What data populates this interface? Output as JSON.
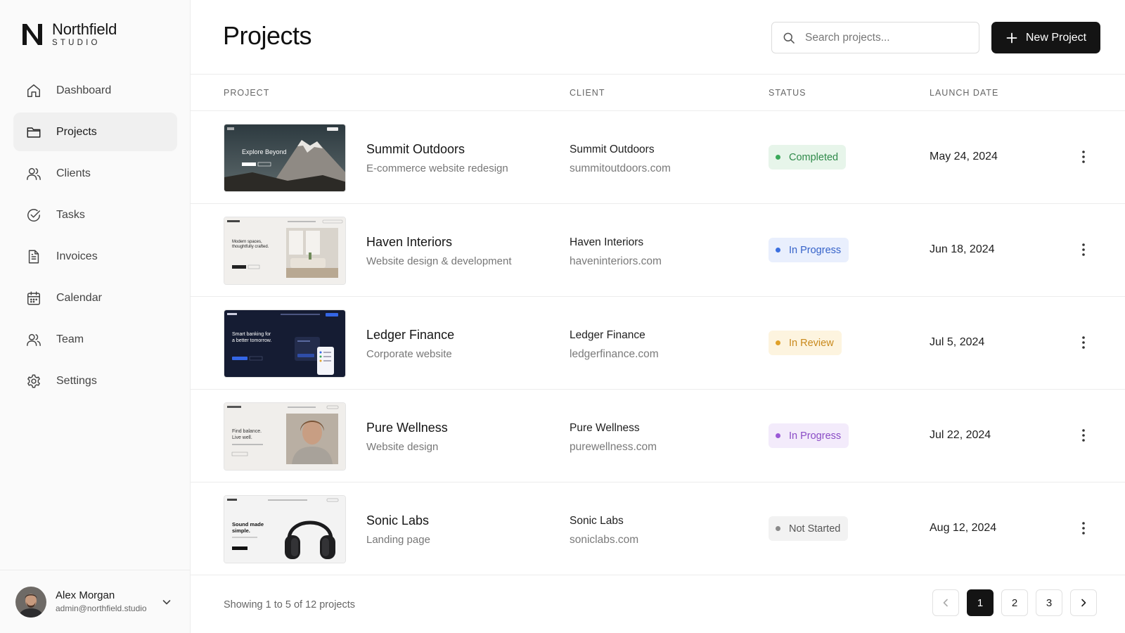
{
  "brand": {
    "name": "Northfield",
    "sub": "STUDIO"
  },
  "nav": {
    "items": [
      {
        "label": "Dashboard",
        "icon": "home-icon"
      },
      {
        "label": "Projects",
        "icon": "folder-icon",
        "active": true
      },
      {
        "label": "Clients",
        "icon": "users-icon"
      },
      {
        "label": "Tasks",
        "icon": "check-circle-icon"
      },
      {
        "label": "Invoices",
        "icon": "document-icon"
      },
      {
        "label": "Calendar",
        "icon": "calendar-icon"
      },
      {
        "label": "Team",
        "icon": "team-icon"
      },
      {
        "label": "Settings",
        "icon": "gear-icon"
      }
    ]
  },
  "user": {
    "name": "Alex Morgan",
    "email": "admin@northfield.studio"
  },
  "header": {
    "title": "Projects",
    "search_placeholder": "Search projects...",
    "new_button": "New Project"
  },
  "table": {
    "columns": [
      "PROJECT",
      "CLIENT",
      "STATUS",
      "LAUNCH DATE"
    ],
    "rows": [
      {
        "name": "Summit Outdoors",
        "description": "E-commerce website redesign",
        "client": "Summit Outdoors",
        "url": "summitoutdoors.com",
        "status": "Completed",
        "status_color": "#3aa95a",
        "status_bg": "#e7f5ea",
        "status_text_color": "#2f8a4a",
        "date": "May 24, 2024",
        "thumb": {
          "headline": "Explore Beyond"
        }
      },
      {
        "name": "Haven Interiors",
        "description": "Website design & development",
        "client": "Haven Interiors",
        "url": "haveninteriors.com",
        "status": "In Progress",
        "status_color": "#3b6fe0",
        "status_bg": "#e9effd",
        "status_text_color": "#3562c9",
        "date": "Jun 18, 2024",
        "thumb": {
          "headline": "Modern spaces, thoughtfully crafted."
        }
      },
      {
        "name": "Ledger Finance",
        "description": "Corporate website",
        "client": "Ledger Finance",
        "url": "ledgerfinance.com",
        "status": "In Review",
        "status_color": "#e0a12a",
        "status_bg": "#fdf4df",
        "status_text_color": "#c9891c",
        "date": "Jul 5, 2024",
        "thumb": {
          "headline": "Smart banking for a better tomorrow."
        }
      },
      {
        "name": "Pure Wellness",
        "description": "Website design",
        "client": "Pure Wellness",
        "url": "purewellness.com",
        "status": "In Progress",
        "status_color": "#9b59d6",
        "status_bg": "#f3ebfb",
        "status_text_color": "#8a4cc6",
        "date": "Jul 22, 2024",
        "thumb": {
          "headline": "Find balance. Live well."
        }
      },
      {
        "name": "Sonic Labs",
        "description": "Landing page",
        "client": "Sonic Labs",
        "url": "soniclabs.com",
        "status": "Not Started",
        "status_color": "#8a8a8a",
        "status_bg": "#f2f2f2",
        "status_text_color": "#555555",
        "date": "Aug 12, 2024",
        "thumb": {
          "headline": "Sound made simple."
        }
      }
    ]
  },
  "footer": {
    "summary": "Showing 1 to 5 of 12 projects",
    "pages": [
      "1",
      "2",
      "3"
    ],
    "current_page": "1"
  }
}
